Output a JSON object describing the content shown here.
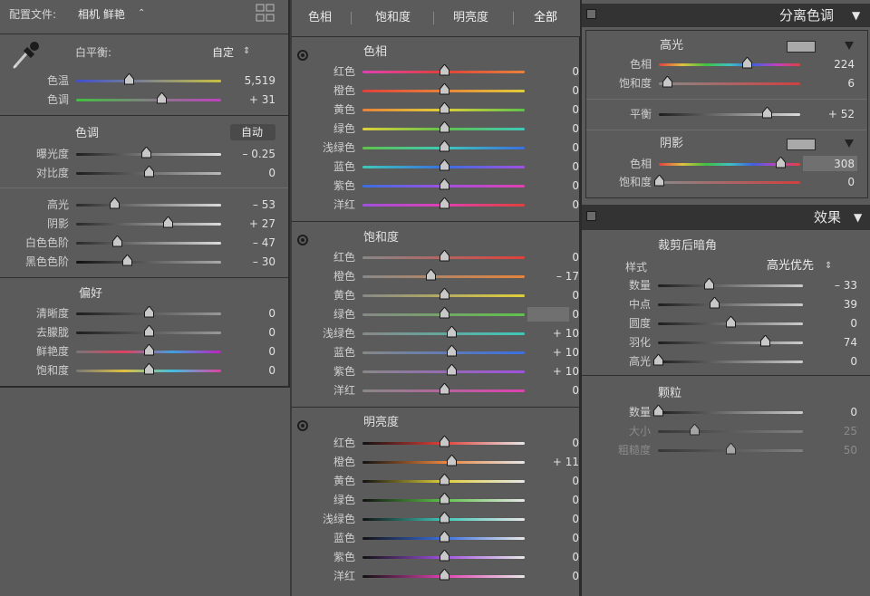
{
  "left": {
    "profile_label": "配置文件:",
    "profile_value": "相机 鲜艳",
    "wb_label": "白平衡:",
    "wb_value": "自定",
    "temp": {
      "label": "色温",
      "value": "5,519",
      "pos": 0.36
    },
    "tint": {
      "label": "色调",
      "value": "+ 31",
      "pos": 0.59
    },
    "tone_title": "色调",
    "auto": "自动",
    "exposure": {
      "label": "曝光度",
      "value": "– 0.25",
      "pos": 0.48
    },
    "contrast": {
      "label": "对比度",
      "value": "0",
      "pos": 0.5
    },
    "highlights": {
      "label": "高光",
      "value": "– 53",
      "pos": 0.26
    },
    "shadows": {
      "label": "阴影",
      "value": "+ 27",
      "pos": 0.63
    },
    "whites": {
      "label": "白色色阶",
      "value": "– 47",
      "pos": 0.28
    },
    "blacks": {
      "label": "黑色色阶",
      "value": "– 30",
      "pos": 0.35
    },
    "presence_title": "偏好",
    "clarity": {
      "label": "清晰度",
      "value": "0",
      "pos": 0.5
    },
    "dehaze": {
      "label": "去朦胧",
      "value": "0",
      "pos": 0.5
    },
    "vibrance": {
      "label": "鲜艳度",
      "value": "0",
      "pos": 0.5
    },
    "saturation": {
      "label": "饱和度",
      "value": "0",
      "pos": 0.5
    }
  },
  "hsl": {
    "tabs": [
      "色相",
      "饱和度",
      "明亮度",
      "全部"
    ],
    "hue_title": "色相",
    "sat_title": "饱和度",
    "lum_title": "明亮度",
    "colors": [
      "红色",
      "橙色",
      "黄色",
      "绿色",
      "浅绿色",
      "蓝色",
      "紫色",
      "洋红"
    ],
    "hue_values": [
      "0",
      "0",
      "0",
      "0",
      "0",
      "0",
      "0",
      "0"
    ],
    "hue_pos": [
      0.5,
      0.5,
      0.5,
      0.5,
      0.5,
      0.5,
      0.5,
      0.5
    ],
    "sat_values": [
      "0",
      "– 17",
      "0",
      "0",
      "+ 10",
      "+ 10",
      "+ 10",
      "0"
    ],
    "sat_pos": [
      0.5,
      0.42,
      0.5,
      0.5,
      0.55,
      0.55,
      0.55,
      0.5
    ],
    "lum_values": [
      "0",
      "+ 11",
      "0",
      "0",
      "0",
      "0",
      "0",
      "0"
    ],
    "lum_pos": [
      0.5,
      0.55,
      0.5,
      0.5,
      0.5,
      0.5,
      0.5,
      0.5
    ],
    "track_colors": [
      "#e0403a",
      "#e8833a",
      "#e0cf3a",
      "#5fc34a",
      "#3ec8b8",
      "#3a6fe0",
      "#a050e0",
      "#e040b0"
    ]
  },
  "split": {
    "header": "分离色调",
    "highlights_title": "高光",
    "hl_hue": {
      "label": "色相",
      "value": "224",
      "pos": 0.62
    },
    "hl_sat": {
      "label": "饱和度",
      "value": "6",
      "pos": 0.06
    },
    "balance": {
      "label": "平衡",
      "value": "+ 52",
      "pos": 0.76
    },
    "shadows_title": "阴影",
    "sh_hue": {
      "label": "色相",
      "value": "308",
      "pos": 0.86
    },
    "sh_sat": {
      "label": "饱和度",
      "value": "0",
      "pos": 0.0
    }
  },
  "effects": {
    "header": "效果",
    "vignette_title": "裁剪后暗角",
    "style_label": "样式",
    "style_value": "高光优先",
    "amount": {
      "label": "数量",
      "value": "– 33",
      "pos": 0.35
    },
    "midpoint": {
      "label": "中点",
      "value": "39",
      "pos": 0.39
    },
    "roundness": {
      "label": "圆度",
      "value": "0",
      "pos": 0.5
    },
    "feather": {
      "label": "羽化",
      "value": "74",
      "pos": 0.74
    },
    "highlights": {
      "label": "高光",
      "value": "0",
      "pos": 0.0
    },
    "grain_title": "颗粒",
    "g_amount": {
      "label": "数量",
      "value": "0",
      "pos": 0.0
    },
    "g_size": {
      "label": "大小",
      "value": "25",
      "pos": 0.25
    },
    "g_rough": {
      "label": "粗糙度",
      "value": "50",
      "pos": 0.5
    }
  }
}
